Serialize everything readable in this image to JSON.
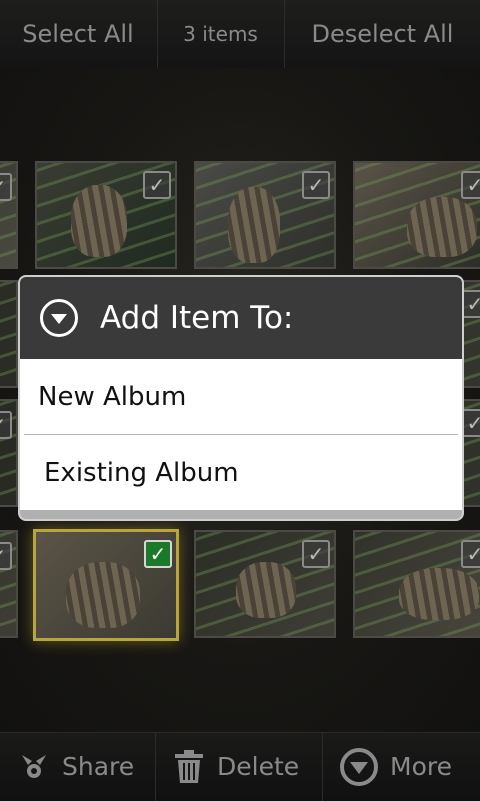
{
  "top_bar": {
    "select_all": "Select All",
    "item_count": "3 items",
    "deselect_all": "Deselect All"
  },
  "dialog": {
    "title": "Add Item To:",
    "options": [
      "New Album",
      "Existing Album"
    ],
    "icon": "chevron-down-circle-icon"
  },
  "bottom_bar": {
    "share": "Share",
    "delete": "Delete",
    "more": "More",
    "icons": [
      "share-icon",
      "trash-icon",
      "chevron-down-circle-icon"
    ]
  },
  "thumbnails": {
    "row_1": [
      {
        "checked": false
      },
      {
        "checked": false
      },
      {
        "checked": false
      },
      {
        "checked": false
      }
    ],
    "row_4": [
      {
        "checked": false
      },
      {
        "checked": true
      },
      {
        "checked": false
      },
      {
        "checked": false
      }
    ]
  },
  "colors": {
    "checked": "#1b7a2a",
    "selected_border": "#b8a63a",
    "dialog_header": "#3a3a3a"
  }
}
